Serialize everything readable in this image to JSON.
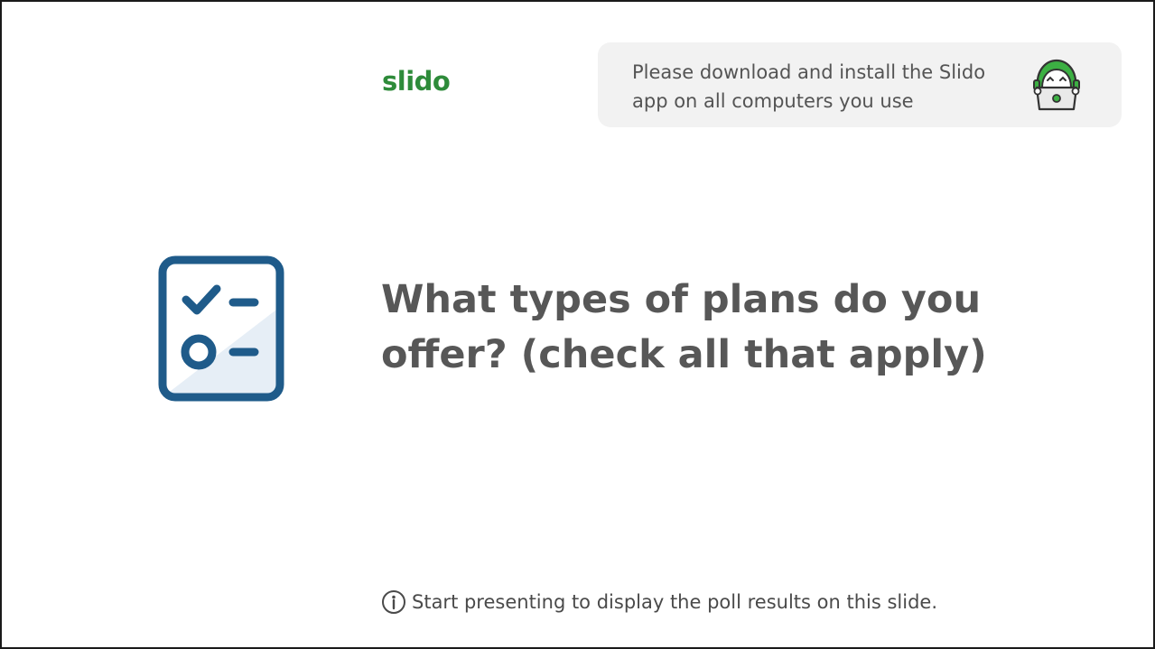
{
  "slide": {
    "brand": "slido",
    "banner": {
      "message": "Please download and install the Slido app on all computers you use",
      "mascot_icon": "slido-mascot-laptop-icon"
    },
    "poll_icon": "poll-checklist-icon",
    "question": "What types of plans do you offer? (check all that apply)",
    "footer_note": "Start presenting to display the poll results on this slide.",
    "info_icon": "info-circle-icon"
  },
  "colors": {
    "brand_green": "#2e8b3a",
    "icon_blue": "#1f5b8a",
    "icon_fill": "#e6eef6",
    "banner_bg": "#f2f2f2",
    "text_gray": "#575757"
  }
}
